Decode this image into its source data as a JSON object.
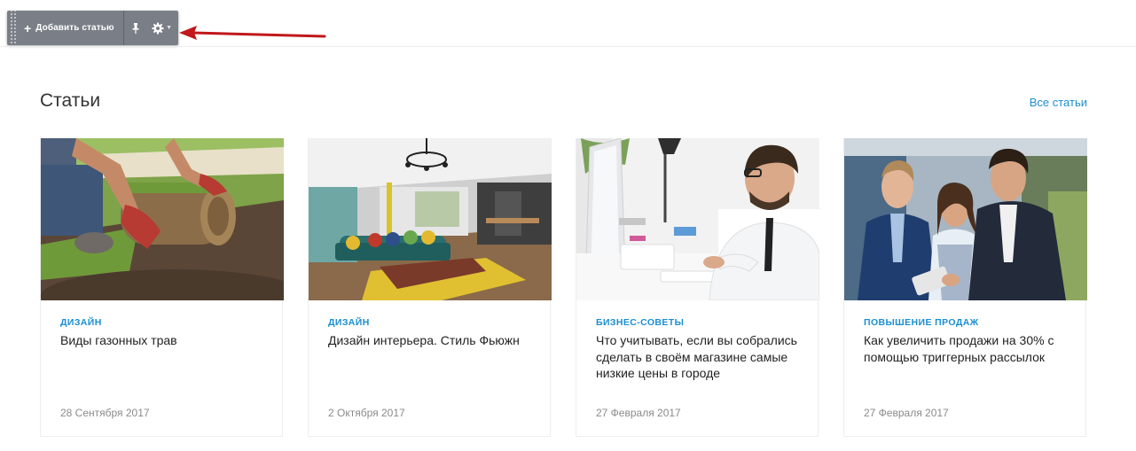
{
  "toolbar": {
    "add_label": "Добавить статью",
    "pin_icon": "pin-icon",
    "gear_icon": "gear-icon"
  },
  "section": {
    "title": "Статьи",
    "all_link": "Все статьи"
  },
  "colors": {
    "accent": "#1a8fd2",
    "toolbar_bg": "#7a7f87",
    "arrow": "#c0181b"
  },
  "articles": [
    {
      "category": "ДИЗАЙН",
      "title": "Виды газонных трав",
      "date": "28 Сентября 2017",
      "image": "lawn-turf-photo"
    },
    {
      "category": "ДИЗАЙН",
      "title": "Дизайн интерьера. Стиль Фьюжн",
      "date": "2 Октября 2017",
      "image": "interior-room-photo"
    },
    {
      "category": "БИЗНЕС-СОВЕТЫ",
      "title": "Что учитывать, если вы собрались сделать в своём магазине самые низкие цены в городе",
      "date": "27 Февраля 2017",
      "image": "man-at-computer-photo"
    },
    {
      "category": "ПОВЫШЕНИЕ ПРОДАЖ",
      "title": "Как увеличить продажи на 30% с помощью триггерных рассылок",
      "date": "27 Февраля 2017",
      "image": "business-people-photo"
    }
  ]
}
